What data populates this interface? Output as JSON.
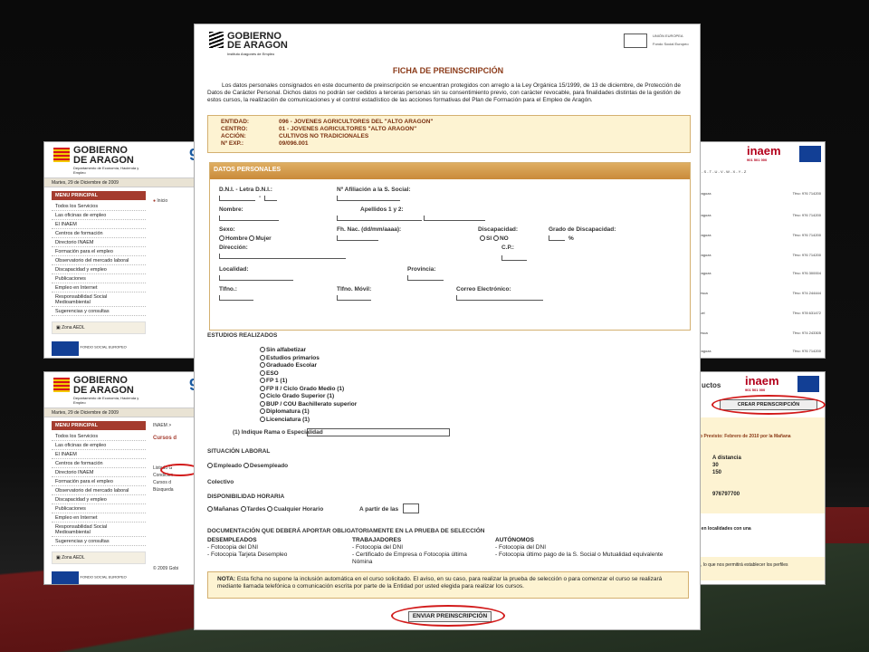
{
  "left_top": {
    "gov_name_1": "GOBIERNO",
    "gov_name_2": "DE ARAGON",
    "gov_sub": "Departamento de Economía, Hacienda y Empleo",
    "date": "Martes, 29 de Diciembre de 2009",
    "menu_title": "MENU PRINCIPAL",
    "menu_items": [
      "Todos los Servicios",
      "Las oficinas de empleo",
      "El INAEM",
      "Centros de formación",
      "Directorio INAEM",
      "Formación para el empleo",
      "Observatorio del mercado laboral",
      "Discapacidad y empleo",
      "Publicaciones",
      "Empleo en Internet",
      "Responsabilidad Social Medioambiental",
      "Sugerencias y consultas"
    ],
    "zone_label": "Zona AEDL",
    "breadcrumb": "Inicio",
    "eu_caption": "FONDO SOCIAL EUROPEO"
  },
  "left_bottom": {
    "gov_name_1": "GOBIERNO",
    "gov_name_2": "DE ARAGON",
    "gov_sub": "Departamento de Economía, Hacienda y Empleo",
    "date": "Martes, 29 de Diciembre de 2009",
    "menu_title": "MENU PRINCIPAL",
    "menu_items": [
      "Todos los Servicios",
      "Las oficinas de empleo",
      "El INAEM",
      "Centros de formación",
      "Directorio INAEM",
      "Formación para el empleo",
      "Observatorio del mercado laboral",
      "Discapacidad y empleo",
      "Publicaciones",
      "Empleo en Internet",
      "Responsabilidad Social Medioambiental",
      "Sugerencias y consultas"
    ],
    "zone_label": "Zona AEDL",
    "breadcrumb": "INAEM >",
    "section": "Cursos d",
    "side_links": [
      "Listado G",
      "Condicion",
      "Cursos d",
      "Búsqueda"
    ],
    "copyright": "© 2009 Gobi",
    "eu_caption": "FONDO SOCIAL EUROPEO"
  },
  "right_top": {
    "brand": "inaem",
    "phone": "901 501 000",
    "alphabet": "R - S - T - U - V - W - X - Y - Z",
    "rows": [
      {
        "city": "aragoza",
        "phone": "Tfno: 976 714200"
      },
      {
        "city": "aragoza",
        "phone": "Tfno: 976 714200"
      },
      {
        "city": "aragoza",
        "phone": "Tfno: 976 714200"
      },
      {
        "city": "aragoza",
        "phone": "Tfno: 976 714200"
      },
      {
        "city": "aragoza",
        "phone": "Tfno: 976 300004"
      },
      {
        "city": "uesca",
        "phone": "Tfno: 974 244444"
      },
      {
        "city": "iruel",
        "phone": "Tfno: 978 631472"
      },
      {
        "city": "uesca",
        "phone": "Tfno: 974 243305"
      },
      {
        "city": "aragoza",
        "phone": "Tfno: 976 714200"
      }
    ]
  },
  "right_bottom": {
    "products": "uctos",
    "brand": "inaem",
    "phone": "901 501 000",
    "crear_button": "CREAR PREINSCRIPCIÓN",
    "inicio": "Inicio Previsto: Febrero de 2010 por la Mañana",
    "modalidad": "A distancia",
    "v1": "30",
    "v2": "150",
    "tel": "976797700",
    "note": "ntes en localidades con una",
    "footer_note": "tores, lo que nos permitirá establecer los perfiles"
  },
  "form": {
    "logo_1": "GOBIERNO",
    "logo_2": "DE ARAGON",
    "logo_sub": "Instituto Aragonés de Empleo",
    "eu_text_1": "UNIÓN EUROPEA",
    "eu_text_2": "Fondo Social Europeo",
    "title": "FICHA DE PREINSCRIPCIÓN",
    "intro": "Los datos personales consignados en este documento de preinscripción se encuentran protegidos con arreglo a la Ley Orgánica 15/1999, de 13 de diciembre, de Protección de Datos de Carácter Personal. Dichos datos no podrán ser cedidos a terceras personas sin su consentimiento previo, con carácter revocable, para finalidades distintas de la gestión de estos cursos, la realización de comunicaciones y el control estadístico de las acciones formativas del Plan de Formación para el Empleo de Aragón.",
    "entity": [
      {
        "label": "ENTIDAD:",
        "value": "096 - JOVENES AGRICULTORES DEL \"ALTO ARAGON\""
      },
      {
        "label": "CENTRO:",
        "value": "01 - JOVENES AGRICULTORES \"ALTO ARAGON\""
      },
      {
        "label": "ACCIÓN:",
        "value": "CULTIVOS NO TRADICIONALES"
      },
      {
        "label": "Nº EXP.:",
        "value": "09/096.001"
      }
    ],
    "datos_title": "DATOS PERSONALES",
    "labels": {
      "dni": "D.N.I. - Letra D.N.I.:",
      "afiliacion": "Nº Afiliación a la S. Social:",
      "nombre": "Nombre:",
      "apellidos": "Apellidos 1 y 2:",
      "sexo": "Sexo:",
      "hombre": "Hombre",
      "mujer": "Mujer",
      "fh_nac": "Fh. Nac. (dd/mm/aaaa):",
      "discapacidad": "Discapacidad:",
      "si": "SI",
      "no": "NO",
      "grado": "Grado de Discapacidad:",
      "pct": "%",
      "direccion": "Dirección:",
      "cp": "C.P.:",
      "localidad": "Localidad:",
      "provincia": "Provincia:",
      "tlfno": "Tlfno.:",
      "movil": "Tlfno. Móvil:",
      "correo": "Correo Electrónico:",
      "dash": "-"
    },
    "estudios_title": "ESTUDIOS REALIZADOS",
    "estudios": [
      "Sin alfabetizar",
      "Estudios primarios",
      "Graduado Escolar",
      "ESO",
      "FP 1 (1)",
      "FP II / Ciclo Grado Medio (1)",
      "Ciclo Grado Superior (1)",
      "BUP / COU Bachillerato superior",
      "Diplomatura (1)",
      "Licenciatura (1)"
    ],
    "rama_label": "(1) Indique Rama o Especialidad",
    "situacion_title": "SITUACIÓN LABORAL",
    "empleado": "Empleado",
    "desempleado": "Desempleado",
    "colectivo": "Colectivo",
    "disponibilidad_title": "DISPONIBILIDAD HORARIA",
    "mananas": "Mañanas",
    "tardes": "Tardes",
    "cualquier": "Cualquier Horario",
    "partir": "A partir de las",
    "doc_title": "DOCUMENTACIÓN QUE DEBERÁ APORTAR OBLIGATORIAMENTE EN LA PRUEBA DE SELECCIÓN",
    "desempleados_title": "DESEMPLEADOS",
    "desempleados": [
      "- Fotocopia del DNI",
      "- Fotocopia Tarjeta Desempleo"
    ],
    "trabajadores_title": "TRABAJADORES",
    "trabajadores": [
      "- Fotocopia del DNI",
      "- Certificado de Empresa o Fotocopia última Nómina"
    ],
    "autonomos_title": "AUTÓNOMOS",
    "autonomos": [
      "- Fotocopia del DNI",
      "- Fotocopia último pago de la S. Social o Mutualidad equivalente"
    ],
    "nota_label": "NOTA:",
    "nota": "Esta ficha no supone la inclusión automática en el curso solicitado. El aviso, en su caso, para realizar la prueba de selección o para comenzar el curso se realizará mediante llamada telefónica o comunicación escrita por parte de la Entidad por usted elegida para realizar los cursos.",
    "enviar_button": "ENVIAR PREINSCRIPCIÓN"
  },
  "colors": {
    "accent": "#a43b2e",
    "form_title": "#8b3a18",
    "highlight_oval": "#d21a1a",
    "panel_bg": "#fdf3d2",
    "header_gold": "#c98a3a"
  }
}
